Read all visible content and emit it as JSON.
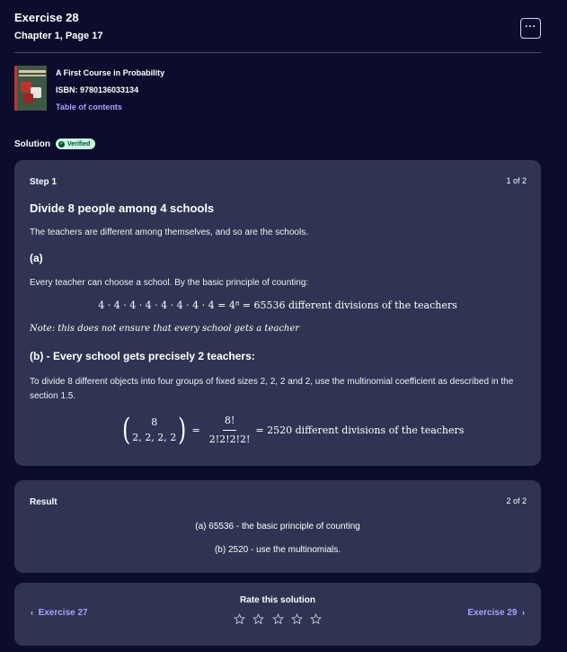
{
  "header": {
    "title": "Exercise 28",
    "subtitle": "Chapter 1, Page 17",
    "menu_label": "···"
  },
  "book": {
    "title": "A First Course in Probability",
    "isbn": "ISBN: 9780136033134",
    "toc_link": "Table of contents",
    "cover_icon": "book-cover-image"
  },
  "solution": {
    "label": "Solution",
    "badge": "Verified",
    "badge_icon": "check-circle-icon",
    "badge_color": "#c6f5e0"
  },
  "step": {
    "label": "Step 1",
    "count": "1 of 2",
    "heading": "Divide 8 people among 4 schools",
    "intro": "The teachers are different among themselves, and so are the schools.",
    "part_a": "(a)",
    "part_a_text": "Every teacher can choose a school. By the basic principle of counting:",
    "equation_a": "4 · 4 · 4 · 4 · 4 · 4 · 4 · 4 = 4⁸ = 65536 different divisions of the teachers",
    "note": "Note: this does not ensure that every school gets a teacher",
    "part_b": "(b) - Every school gets precisely 2 teachers:",
    "part_b_text": "To divide 8 different objects into four groups of fixed sizes 2, 2, 2 and 2, use the multinomial coefficient as described in the section 1.5.",
    "binom_top": "8",
    "binom_bottom": "2, 2, 2, 2",
    "frac_num": "8!",
    "frac_den": "2!2!2!2!",
    "equation_b_result": "= 2520 different divisions of the teachers"
  },
  "result": {
    "label": "Result",
    "count": "2 of 2",
    "line_a": "(a) 65536 - the basic principle of counting",
    "line_b": "(b) 2520 - use the multinomials."
  },
  "nav": {
    "prev": "Exercise 27",
    "next": "Exercise 29",
    "rate_label": "Rate this solution",
    "rating": 0,
    "rating_max": 5,
    "accent": "#a8a2ff"
  }
}
